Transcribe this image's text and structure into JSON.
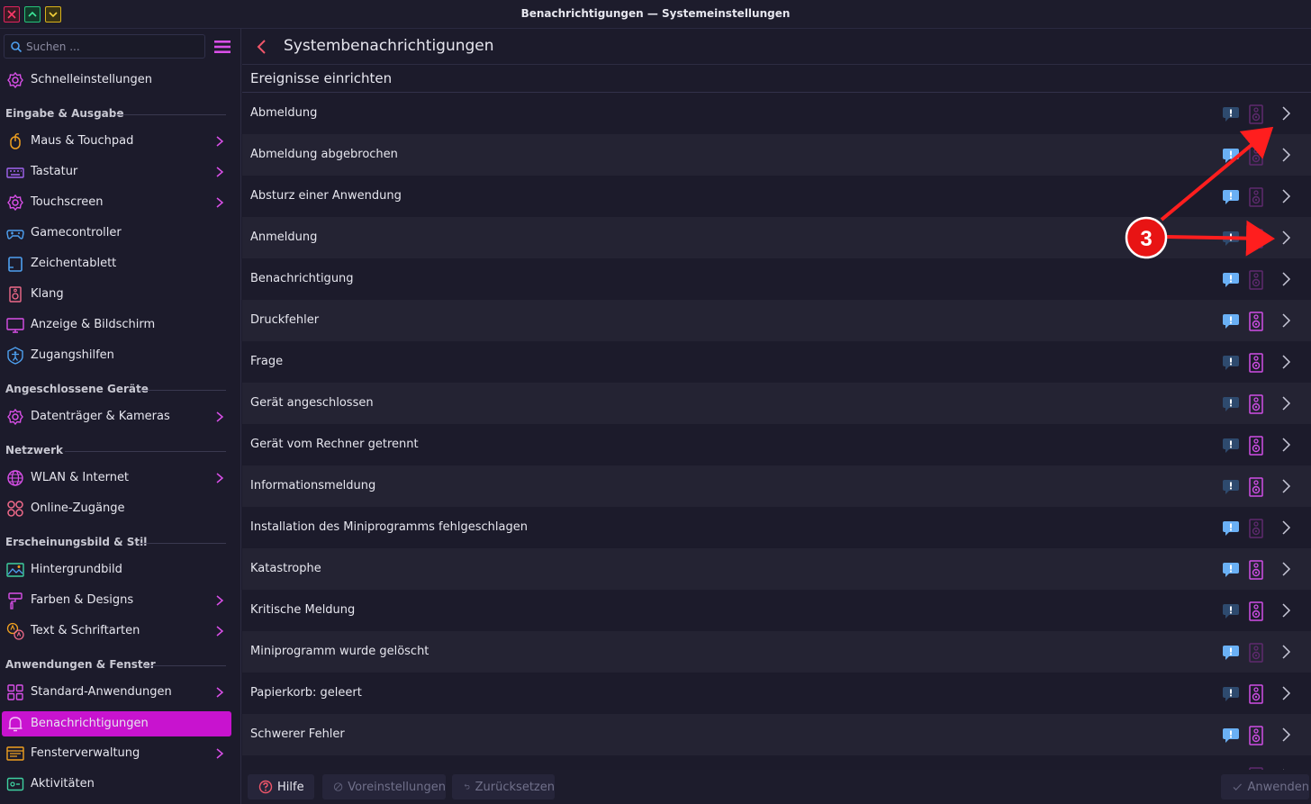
{
  "window": {
    "title": "Benachrichtigungen — Systemeinstellungen"
  },
  "colors": {
    "accent": "#c813cf",
    "bubble_on": "#6ab0f5",
    "bubble_off": "#2e4a6e",
    "speaker_on": "#d04ee6",
    "speaker_off": "#5e2a6e",
    "annotation": "#ff1e1e"
  },
  "search": {
    "placeholder": "Suchen ..."
  },
  "sidebar": {
    "quick": "Schnelleinstellungen",
    "sections": {
      "s1": "Eingabe & Ausgabe",
      "s2": "Angeschlossene Geräte",
      "s3": "Netzwerk",
      "s4": "Erscheinungsbild & Stil",
      "s5": "Anwendungen & Fenster"
    },
    "items": {
      "maus": "Maus & Touchpad",
      "tastatur": "Tastatur",
      "touchscreen": "Touchscreen",
      "gamecontroller": "Gamecontroller",
      "zeichentablett": "Zeichentablett",
      "klang": "Klang",
      "anzeige": "Anzeige & Bildschirm",
      "zugangshilfen": "Zugangshilfen",
      "datentraeger": "Datenträger & Kameras",
      "wlan": "WLAN & Internet",
      "online": "Online-Zugänge",
      "hintergrund": "Hintergrundbild",
      "farben": "Farben & Designs",
      "text": "Text & Schriftarten",
      "standard": "Standard-Anwendungen",
      "benachrichtigungen": "Benachrichtigungen",
      "fenster": "Fensterverwaltung",
      "aktivitaeten": "Aktivitäten"
    }
  },
  "header": {
    "title": "Systembenachrichtigungen"
  },
  "section_title": "Ereignisse einrichten",
  "events": [
    {
      "label": "Abmeldung",
      "popup": false,
      "sound": false
    },
    {
      "label": "Abmeldung abgebrochen",
      "popup": true,
      "sound": false
    },
    {
      "label": "Absturz einer Anwendung",
      "popup": true,
      "sound": false
    },
    {
      "label": "Anmeldung",
      "popup": false,
      "sound": false
    },
    {
      "label": "Benachrichtigung",
      "popup": true,
      "sound": false
    },
    {
      "label": "Druckfehler",
      "popup": true,
      "sound": true
    },
    {
      "label": "Frage",
      "popup": false,
      "sound": true
    },
    {
      "label": "Gerät angeschlossen",
      "popup": false,
      "sound": true
    },
    {
      "label": "Gerät vom Rechner getrennt",
      "popup": false,
      "sound": true
    },
    {
      "label": "Informationsmeldung",
      "popup": false,
      "sound": true
    },
    {
      "label": "Installation des Miniprogramms fehlgeschlagen",
      "popup": true,
      "sound": false
    },
    {
      "label": "Katastrophe",
      "popup": true,
      "sound": true
    },
    {
      "label": "Kritische Meldung",
      "popup": false,
      "sound": true
    },
    {
      "label": "Miniprogramm wurde gelöscht",
      "popup": true,
      "sound": false
    },
    {
      "label": "Papierkorb: geleert",
      "popup": false,
      "sound": true
    },
    {
      "label": "Schwerer Fehler",
      "popup": true,
      "sound": true
    },
    {
      "label": "",
      "popup": false,
      "sound": false
    }
  ],
  "footer": {
    "help": "Hilfe",
    "defaults": "Voreinstellungen",
    "reset": "Zurücksetzen",
    "apply": "Anwenden"
  },
  "annotation": {
    "label": "3"
  }
}
